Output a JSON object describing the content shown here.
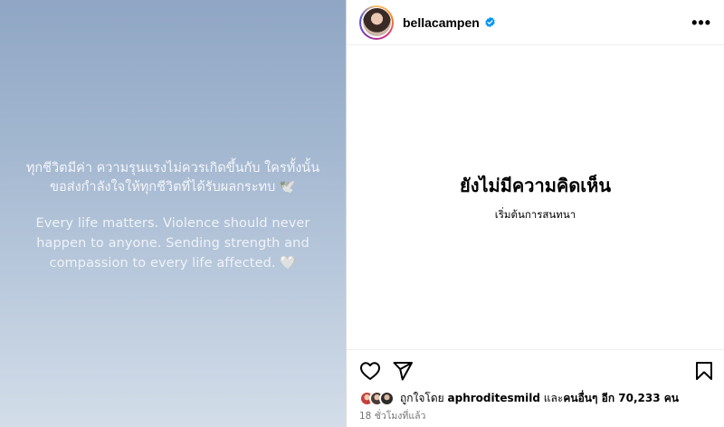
{
  "media": {
    "thai_lines": [
      "ทุกชีวิตมีค่า ความรุนแรงไม่ควรเกิดขึ้นกับ ใครทั้งนั้น",
      "ขอส่งกำลังใจให้ทุกชีวิตที่ได้รับผลกระทบ 🕊️"
    ],
    "english_lines": [
      "Every life matters. Violence should never",
      "happen to anyone. Sending strength and",
      "compassion to every life affected. 🤍"
    ],
    "background_top": "#8fa6c4",
    "background_bottom": "#d3dde9"
  },
  "header": {
    "username": "bellacampen",
    "verified_icon": "verified-badge-icon",
    "more_label": "•••"
  },
  "comments": {
    "empty_title": "ยังไม่มีความคิดเห็น",
    "empty_subtitle": "เริ่มต้นการสนทนา"
  },
  "actions": {
    "like_icon": "heart-icon",
    "share_icon": "send-icon",
    "save_icon": "bookmark-icon"
  },
  "likes": {
    "prefix": "ถูกใจโดย",
    "user": "aphroditesmild",
    "middle": "และ",
    "others": "คนอื่นๆ อีก 70,233 คน"
  },
  "timestamp": "18 ชั่วโมงที่แล้ว",
  "colors": {
    "verified": "#0095f6",
    "muted_text": "#737373",
    "border": "#dbdbdb"
  }
}
